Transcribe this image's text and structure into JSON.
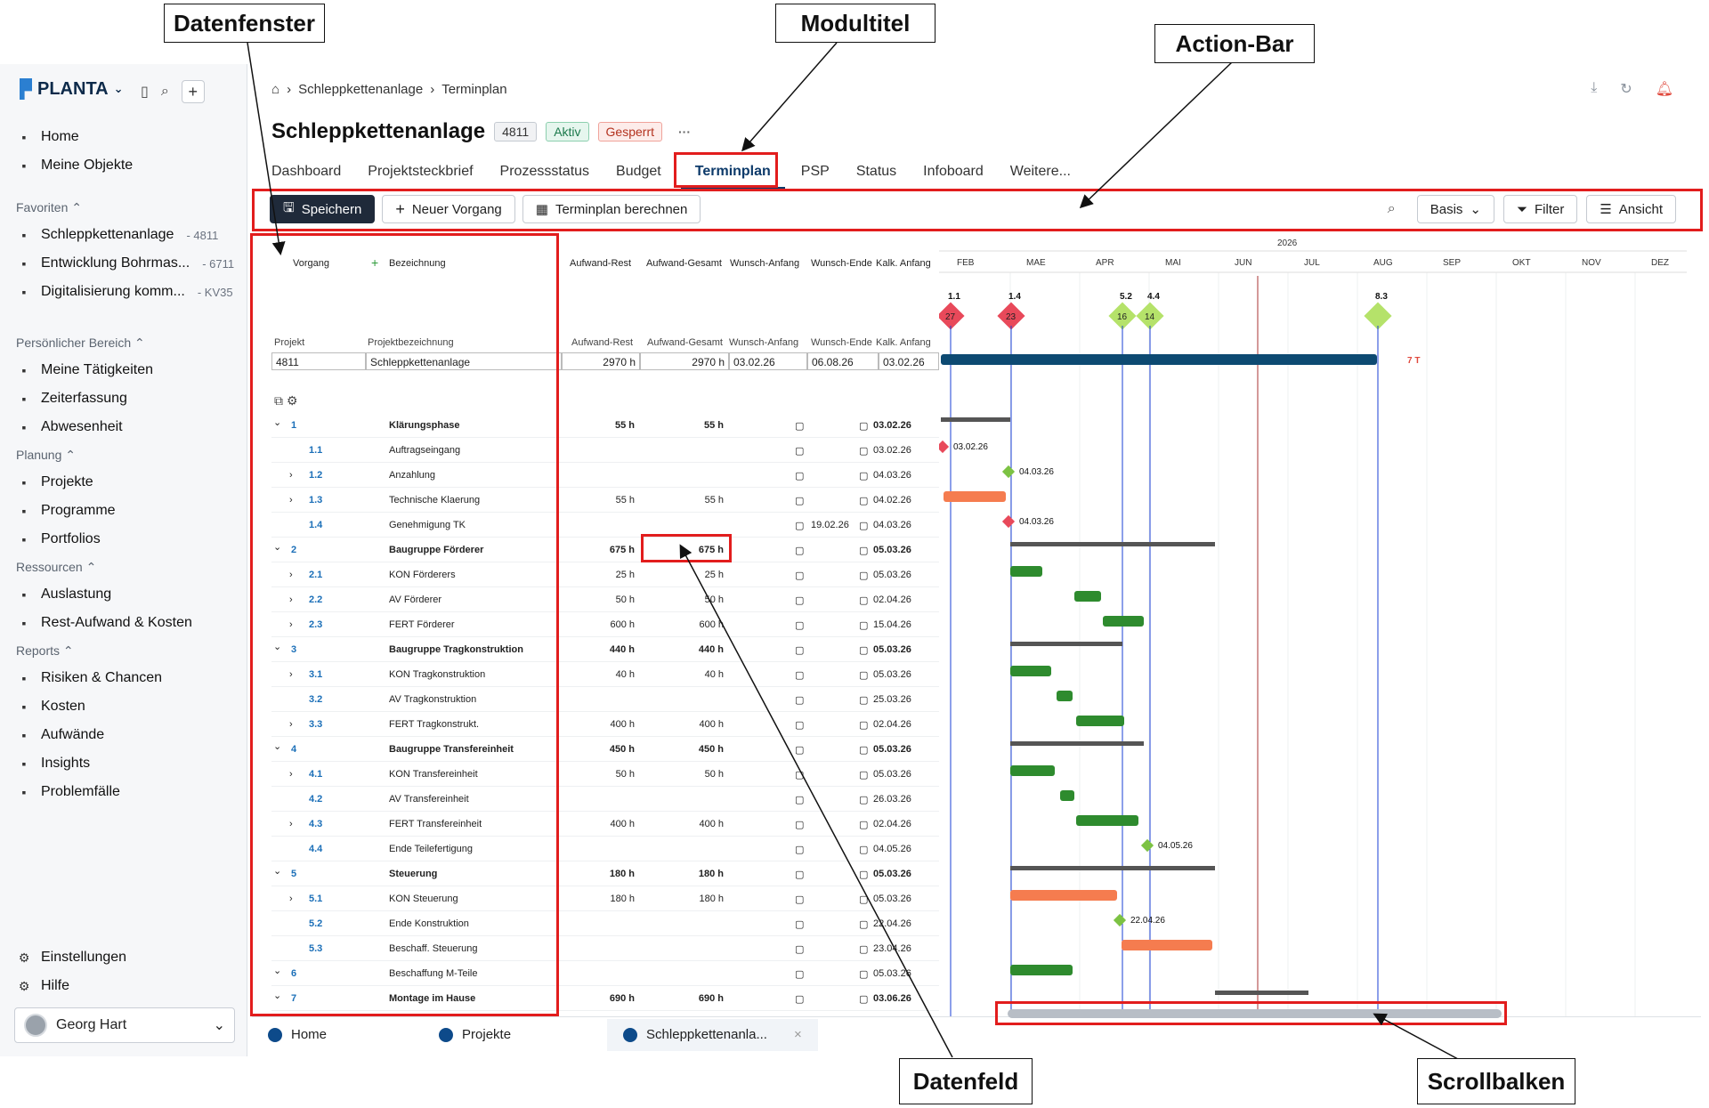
{
  "callouts": {
    "datenfenster": "Datenfenster",
    "modultitel": "Modultitel",
    "actionbar": "Action-Bar",
    "datenfeld": "Datenfeld",
    "scrollbalken": "Scrollbalken"
  },
  "app": {
    "logo": "PLANTA"
  },
  "sidebar": {
    "main": [
      {
        "label": "Home",
        "icon": "home-icon"
      },
      {
        "label": "Meine Objekte",
        "icon": "grid-icon"
      }
    ],
    "favorites_title": "Favoriten",
    "favorites": [
      {
        "label": "Schleppkettenanlage",
        "count": "- 4811"
      },
      {
        "label": "Entwicklung Bohrmas...",
        "count": "- 6711"
      },
      {
        "label": "Digitalisierung komm...",
        "count": "- KV35"
      }
    ],
    "personal_title": "Persönlicher Bereich",
    "personal": [
      {
        "label": "Meine Tätigkeiten"
      },
      {
        "label": "Zeiterfassung"
      },
      {
        "label": "Abwesenheit"
      }
    ],
    "planning_title": "Planung",
    "planning": [
      {
        "label": "Projekte"
      },
      {
        "label": "Programme"
      },
      {
        "label": "Portfolios"
      }
    ],
    "resources_title": "Ressourcen",
    "resources": [
      {
        "label": "Auslastung"
      },
      {
        "label": "Rest-Aufwand & Kosten"
      }
    ],
    "reports_title": "Reports",
    "reports": [
      {
        "label": "Risiken & Chancen"
      },
      {
        "label": "Kosten"
      },
      {
        "label": "Aufwände"
      },
      {
        "label": "Insights"
      },
      {
        "label": "Problemfälle"
      }
    ],
    "bottom": [
      {
        "label": "Einstellungen"
      },
      {
        "label": "Hilfe"
      }
    ],
    "user": "Georg Hart"
  },
  "breadcrumb": {
    "parent": "Schleppkettenanlage",
    "current": "Terminplan"
  },
  "header": {
    "title": "Schleppkettenanlage",
    "id": "4811",
    "status1": "Aktiv",
    "status2": "Gesperrt",
    "more": "···"
  },
  "tabs": [
    "Dashboard",
    "Projektsteckbrief",
    "Prozessstatus",
    "Budget",
    "Terminplan",
    "PSP",
    "Status",
    "Infoboard",
    "Weitere..."
  ],
  "actions": {
    "save": "Speichern",
    "new": "Neuer Vorgang",
    "calc": "Terminplan berechnen",
    "view_select": "Basis",
    "filter": "Filter",
    "view": "Ansicht"
  },
  "table": {
    "head1": {
      "vorgang": "Vorgang",
      "bezeichnung": "Bezeichnung",
      "rest": "Aufwand-Rest",
      "gesamt": "Aufwand-Gesamt",
      "wanfang": "Wunsch-Anfang",
      "wende": "Wunsch-Ende",
      "kanfang": "Kalk. Anfang"
    },
    "head2": {
      "projekt": "Projekt",
      "bez": "Projektbezeichnung",
      "rest": "Aufwand-Rest",
      "gesamt": "Aufwand-Gesamt",
      "wanfang": "Wunsch-Anfang",
      "wende": "Wunsch-Ende",
      "kanfang": "Kalk. Anfang"
    },
    "project": {
      "id": "4811",
      "name": "Schleppkettenanlage",
      "rest": "2970 h",
      "gesamt": "2970 h",
      "wanfang": "03.02.26",
      "wende": "06.08.26",
      "kanfang": "03.02.26"
    },
    "rows": [
      {
        "nr": "1",
        "name": "Klärungsphase",
        "rest": "55 h",
        "ges": "55 h",
        "wende": "",
        "kal": "03.02.26",
        "lvl": 0,
        "bold": true
      },
      {
        "nr": "1.1",
        "name": "Auftragseingang",
        "rest": "",
        "ges": "",
        "wende": "",
        "kal": "03.02.26",
        "lvl": 1
      },
      {
        "nr": "1.2",
        "name": "Anzahlung",
        "rest": "",
        "ges": "",
        "wende": "",
        "kal": "04.03.26",
        "lvl": 1,
        "exp": true
      },
      {
        "nr": "1.3",
        "name": "Technische Klaerung",
        "rest": "55 h",
        "ges": "55 h",
        "wende": "",
        "kal": "04.02.26",
        "lvl": 1,
        "exp": true
      },
      {
        "nr": "1.4",
        "name": "Genehmigung TK",
        "rest": "",
        "ges": "",
        "wende": "19.02.26",
        "kal": "04.03.26",
        "lvl": 1
      },
      {
        "nr": "2",
        "name": "Baugruppe Förderer",
        "rest": "675 h",
        "ges": "675 h",
        "wende": "",
        "kal": "05.03.26",
        "lvl": 0,
        "bold": true
      },
      {
        "nr": "2.1",
        "name": "KON Förderers",
        "rest": "25 h",
        "ges": "25 h",
        "wende": "",
        "kal": "05.03.26",
        "lvl": 1,
        "exp": true
      },
      {
        "nr": "2.2",
        "name": "AV Förderer",
        "rest": "50 h",
        "ges": "50 h",
        "wende": "",
        "kal": "02.04.26",
        "lvl": 1,
        "exp": true
      },
      {
        "nr": "2.3",
        "name": "FERT Förderer",
        "rest": "600 h",
        "ges": "600 h",
        "wende": "",
        "kal": "15.04.26",
        "lvl": 1,
        "exp": true
      },
      {
        "nr": "3",
        "name": "Baugruppe Tragkonstruktion",
        "rest": "440 h",
        "ges": "440 h",
        "wende": "",
        "kal": "05.03.26",
        "lvl": 0,
        "bold": true
      },
      {
        "nr": "3.1",
        "name": "KON Tragkonstruktion",
        "rest": "40 h",
        "ges": "40 h",
        "wende": "",
        "kal": "05.03.26",
        "lvl": 1,
        "exp": true
      },
      {
        "nr": "3.2",
        "name": "AV Tragkonstruktion",
        "rest": "",
        "ges": "",
        "wende": "",
        "kal": "25.03.26",
        "lvl": 1
      },
      {
        "nr": "3.3",
        "name": "FERT Tragkonstrukt.",
        "rest": "400 h",
        "ges": "400 h",
        "wende": "",
        "kal": "02.04.26",
        "lvl": 1,
        "exp": true
      },
      {
        "nr": "4",
        "name": "Baugruppe Transfereinheit",
        "rest": "450 h",
        "ges": "450 h",
        "wende": "",
        "kal": "05.03.26",
        "lvl": 0,
        "bold": true
      },
      {
        "nr": "4.1",
        "name": "KON Transfereinheit",
        "rest": "50 h",
        "ges": "50 h",
        "wende": "",
        "kal": "05.03.26",
        "lvl": 1,
        "exp": true
      },
      {
        "nr": "4.2",
        "name": "AV Transfereinheit",
        "rest": "",
        "ges": "",
        "wende": "",
        "kal": "26.03.26",
        "lvl": 1
      },
      {
        "nr": "4.3",
        "name": "FERT Transfereinheit",
        "rest": "400 h",
        "ges": "400 h",
        "wende": "",
        "kal": "02.04.26",
        "lvl": 1,
        "exp": true
      },
      {
        "nr": "4.4",
        "name": "Ende Teilefertigung",
        "rest": "",
        "ges": "",
        "wende": "",
        "kal": "04.05.26",
        "lvl": 1
      },
      {
        "nr": "5",
        "name": "Steuerung",
        "rest": "180 h",
        "ges": "180 h",
        "wende": "",
        "kal": "05.03.26",
        "lvl": 0,
        "bold": true
      },
      {
        "nr": "5.1",
        "name": "KON Steuerung",
        "rest": "180 h",
        "ges": "180 h",
        "wende": "",
        "kal": "05.03.26",
        "lvl": 1,
        "exp": true
      },
      {
        "nr": "5.2",
        "name": "Ende Konstruktion",
        "rest": "",
        "ges": "",
        "wende": "",
        "kal": "22.04.26",
        "lvl": 1
      },
      {
        "nr": "5.3",
        "name": "Beschaff. Steuerung",
        "rest": "",
        "ges": "",
        "wende": "",
        "kal": "23.04.26",
        "lvl": 1
      },
      {
        "nr": "6",
        "name": "Beschaffung M-Teile",
        "rest": "",
        "ges": "",
        "wende": "",
        "kal": "05.03.26",
        "lvl": 0
      },
      {
        "nr": "7",
        "name": "Montage im Hause",
        "rest": "690 h",
        "ges": "690 h",
        "wende": "",
        "kal": "03.06.26",
        "lvl": 0,
        "bold": true
      }
    ]
  },
  "gantt": {
    "year": "2026",
    "months": [
      "FEB",
      "MAE",
      "APR",
      "MAI",
      "JUN",
      "JUL",
      "AUG",
      "SEP",
      "OKT",
      "NOV",
      "DEZ"
    ],
    "milestones": [
      {
        "label": "1.1",
        "num": "27",
        "color": "#e8495a"
      },
      {
        "label": "1.4",
        "num": "23",
        "color": "#e8495a"
      },
      {
        "label": "5.2",
        "num": "16",
        "color": "#b5e26a"
      },
      {
        "label": "4.4",
        "num": "14",
        "color": "#b5e26a"
      },
      {
        "label": "8.3",
        "num": "",
        "color": "#b5e26a"
      }
    ],
    "project_note": "7 T",
    "date_labels": [
      "03.02.26",
      "04.03.26",
      "04.03.26",
      "04.05.26",
      "22.04.26"
    ],
    "bar_colors": {
      "green": "#2e8b2e",
      "orange": "#f57c4f",
      "summary": "#555555",
      "project": "#0d4a72"
    }
  },
  "bottom_tabs": [
    {
      "label": "Home"
    },
    {
      "label": "Projekte"
    },
    {
      "label": "Schleppkettenanla..."
    }
  ]
}
